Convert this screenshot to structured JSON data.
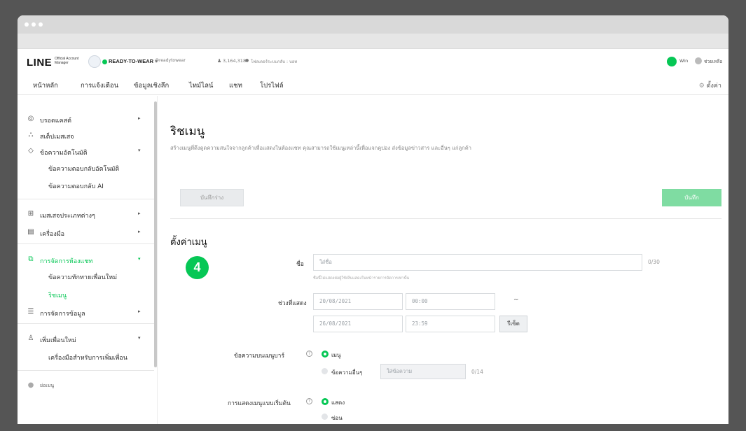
{
  "header": {
    "logo": "LINE",
    "logo_sub": "Official Account Manager",
    "account_name": "READY-TO-WEAR",
    "account_caret": "▾",
    "account_id": "@readytowear",
    "friends_count": "3,164,318",
    "plan": "โฟลเดอร์ระบบกลับ : บอท",
    "user_name": "Win",
    "help": "ช่วยเหลือ"
  },
  "nav": {
    "tabs": [
      "หน้าหลัก",
      "การแจ้งเตือน",
      "ข้อมูลเชิงลึก",
      "ไทม์ไลน์",
      "แชท",
      "โปรไฟล์"
    ],
    "settings": "ตั้งค่า"
  },
  "sidebar": {
    "broadcast": "บรอดแคสต์",
    "display": "สเต็ปเมสเสจ",
    "auto_reply": "ข้อความอัตโนมัติ",
    "auto_reply_sub1": "ข้อความตอบกลับอัตโนมัติ",
    "auto_reply_sub2": "ข้อความตอบกลับ AI",
    "message_types": "เมสเสจประเภทต่างๆ",
    "tools": "เครื่องมือ",
    "chat_manage": "การจัดการห้องแชท",
    "chat_manage_sub1": "ข้อความทักทายเพื่อนใหม่",
    "chat_manage_sub2": "ริชเมนู",
    "data_manage": "การจัดการข้อมูล",
    "add_friends": "เพิ่มเพื่อนใหม่",
    "add_friends_sub1": "เครื่องมือสำหรับการเพิ่มเพื่อน",
    "collapse": "ย่อเมนู",
    "arrow_right": "▸",
    "arrow_down": "▾"
  },
  "main": {
    "title": "ริชเมนู",
    "description": "สร้างเมนูที่ดึงดูดความสนใจจากลูกค้าเพื่อแสดงในห้องแชท คุณสามารถใช้เมนูเหล่านี้เพื่อแจกคูปอง ส่งข้อมูลข่าวสาร และอื่นๆ แก่ลูกค้า",
    "draft_button": "บันทึกร่าง",
    "save_button": "บันทึก",
    "section_title": "ตั้งค่าเมนู",
    "name_label": "ชื่อ",
    "name_placeholder": "ใส่ชื่อ",
    "name_counter": "0/30",
    "name_hint": "ชื่อนี้ไม่แสดงต่อผู้ใช้เห็นแสดงในหน้ารายการจัดการเท่านั้น",
    "period_label": "ช่วงที่แสดง",
    "start_date": "20/08/2021",
    "start_time": "00:00",
    "tilde": "~",
    "end_date": "26/08/2021",
    "end_time": "23:59",
    "reset_button": "รีเซ็ต",
    "menubar_label": "ข้อความบนเมนูบาร์",
    "menubar_opt1": "เมนู",
    "menubar_opt2": "ข้อความอื่นๆ",
    "menubar_placeholder": "ใส่ข้อความ",
    "menubar_counter": "0/14",
    "default_label": "การแสดงเมนูแบบเริ่มต้น",
    "default_opt1": "แสดง",
    "default_opt2": "ซ่อน",
    "info_icon_glyph": "?",
    "step_badge": "4"
  },
  "colors": {
    "brand_green": "#06c755",
    "save_green": "#7fdca2"
  }
}
